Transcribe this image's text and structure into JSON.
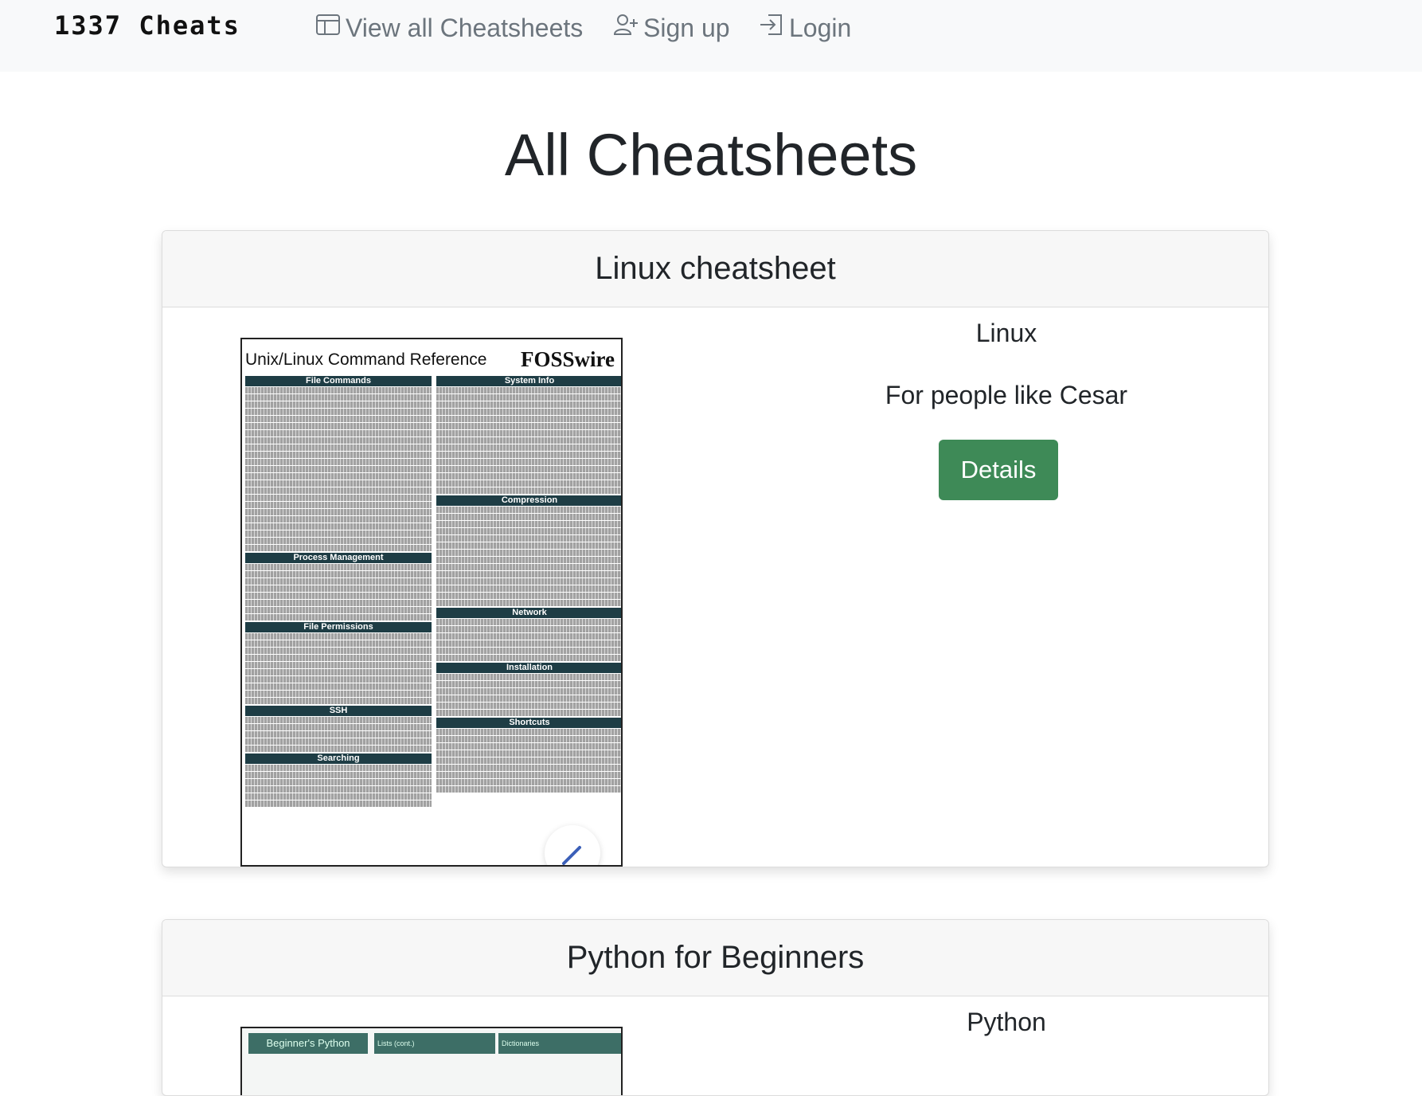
{
  "navbar": {
    "brand": "1337 Cheats",
    "links": [
      {
        "label": "View all Cheatsheets",
        "icon": "table-icon"
      },
      {
        "label": "Sign up",
        "icon": "person-plus-icon"
      },
      {
        "label": "Login",
        "icon": "box-arrow-in-right-icon"
      }
    ]
  },
  "page": {
    "title": "All Cheatsheets"
  },
  "cards": [
    {
      "title": "Linux cheatsheet",
      "category": "Linux",
      "description": "For people like Cesar",
      "button_label": "Details",
      "thumbnail": {
        "title": "Unix/Linux Command Reference",
        "logo": "FOSSwire",
        "sections_left": [
          "File Commands",
          "Process Management",
          "File Permissions",
          "SSH",
          "Searching"
        ],
        "sections_right": [
          "System Info",
          "Compression",
          "Network",
          "Installation",
          "Shortcuts"
        ]
      }
    },
    {
      "title": "Python for Beginners",
      "category": "Python",
      "thumbnail": {
        "headers": [
          "Beginner's Python",
          "Lists (cont.)",
          "Dictionaries"
        ]
      }
    }
  ],
  "colors": {
    "navbar_bg": "#f8f9fa",
    "nav_link": "#6c757d",
    "button_bg": "#3e8a57",
    "card_header_bg": "#f7f7f7"
  }
}
